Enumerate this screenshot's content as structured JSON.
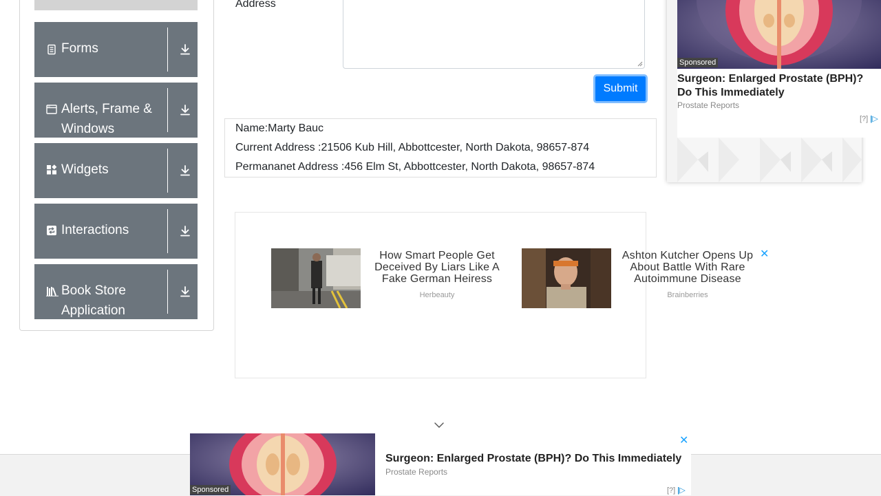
{
  "sidebar": {
    "groups": [
      {
        "label": "Forms",
        "icon": "form-icon"
      },
      {
        "label": "Alerts, Frame & Windows",
        "icon": "window-icon"
      },
      {
        "label": "Widgets",
        "icon": "widgets-icon"
      },
      {
        "label": "Interactions",
        "icon": "interactions-icon"
      },
      {
        "label": "Book Store Application",
        "icon": "books-icon"
      }
    ]
  },
  "form": {
    "address_label": "Address",
    "submit_label": "Submit"
  },
  "output": {
    "name_line": "Name:Marty Bauc",
    "current_address_line": "Current Address :21506 Kub Hill, Abbottcester, North Dakota, 98657-874",
    "permanent_address_line": "Permananet Address :456 Elm St, Abbottcester, North Dakota, 98657-874"
  },
  "mid_ads": [
    {
      "title": "How Smart People Get Deceived By Liars Like A Fake German Heiress",
      "source": "Herbeauty"
    },
    {
      "title": "Ashton Kutcher Opens Up About Battle With Rare Autoimmune Disease",
      "source": "Brainberries"
    }
  ],
  "right_ad": {
    "sponsored": "Sponsored",
    "headline": "Surgeon: Enlarged Prostate (BPH)? Do This Immediately",
    "source": "Prostate Reports",
    "adchoice": "[?]"
  },
  "bottom_ad": {
    "sponsored": "Sponsored",
    "headline": "Surgeon: Enlarged Prostate (BPH)? Do This Immediately",
    "source": "Prostate Reports",
    "adchoice": "[?]",
    "close": "✕"
  },
  "mid_ad_close": "✕",
  "colors": {
    "sidebar_header": "#6c757d",
    "submit": "#007bff",
    "submit_focus_ring": "#80bdff",
    "ad_close": "#1aa3ff"
  }
}
